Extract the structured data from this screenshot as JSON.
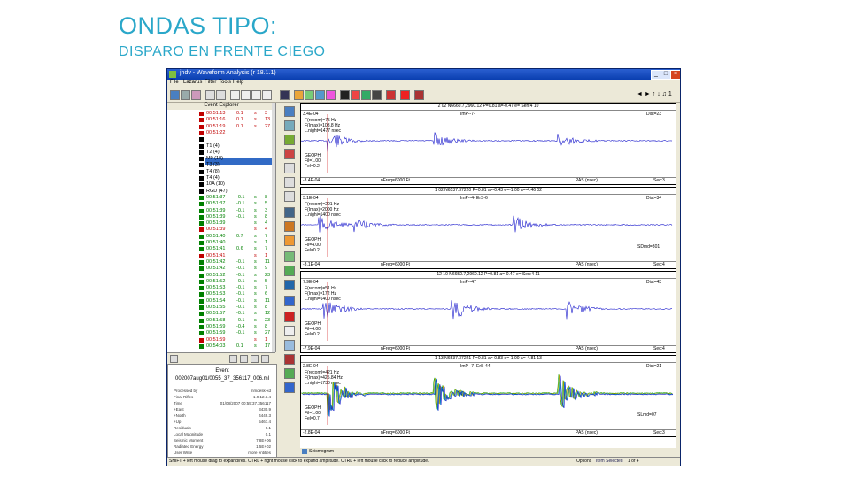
{
  "slide": {
    "title": "ONDAS TIPO:",
    "subtitle": "DISPARO EN FRENTE CIEGO"
  },
  "window": {
    "title": "jhdv - Waveform Analysis (r 18.1.1)",
    "controls": [
      "_",
      "□",
      "×"
    ]
  },
  "menu": [
    "File",
    "Lazarus",
    "Filter",
    "Tools",
    "Help"
  ],
  "toolbar": {
    "right_text": "◄ ► ↑ ↓ ♫ 1"
  },
  "explorer": {
    "header": "Event Explorer",
    "events": [
      {
        "time": "00:51:13",
        "a": "0.1",
        "b": "s",
        "c": "3",
        "color": "#c00000"
      },
      {
        "time": "00:51:16",
        "a": "0.1",
        "b": "s",
        "c": "13",
        "color": "#c00000"
      },
      {
        "time": "00:51:19",
        "a": "0.1",
        "b": "s",
        "c": "27",
        "color": "#c00000"
      },
      {
        "time": "00:51:22",
        "a": "",
        "b": "",
        "c": "",
        "color": "#c00000"
      },
      {
        "time": "T0 (3)",
        "a": "",
        "b": "",
        "c": "",
        "color": "#000000"
      },
      {
        "time": "T1 (4)",
        "a": "",
        "b": "",
        "c": "",
        "color": "#000000"
      },
      {
        "time": "T2 (4)",
        "a": "",
        "b": "",
        "c": "",
        "color": "#000000"
      },
      {
        "time": "M0 (10)",
        "a": "",
        "b": "",
        "c": "",
        "color": "#000000"
      },
      {
        "time": "T3 (3)",
        "a": "",
        "b": "",
        "c": "",
        "color": "#000000"
      },
      {
        "time": "T4 (8)",
        "a": "",
        "b": "",
        "c": "",
        "color": "#000000"
      },
      {
        "time": "T4 (4)",
        "a": "",
        "b": "",
        "c": "",
        "color": "#000000"
      },
      {
        "time": "10A (10)",
        "a": "",
        "b": "",
        "c": "",
        "color": "#000000"
      },
      {
        "time": "RGD (47)",
        "a": "",
        "b": "",
        "c": "",
        "color": "#000000"
      },
      {
        "time": "00:51:37",
        "a": "-0.1",
        "b": "s",
        "c": "8",
        "color": "#008000"
      },
      {
        "time": "00:51:37",
        "a": "-0.1",
        "b": "s",
        "c": "5",
        "color": "#008000"
      },
      {
        "time": "00:51:39",
        "a": "-0.1",
        "b": "s",
        "c": "3",
        "color": "#008000"
      },
      {
        "time": "00:51:39",
        "a": "-0.1",
        "b": "s",
        "c": "8",
        "color": "#008000"
      },
      {
        "time": "00:51:39",
        "a": "",
        "b": "s",
        "c": "4",
        "color": "#008000"
      },
      {
        "time": "00:51:39",
        "a": "",
        "b": "s",
        "c": "4",
        "color": "#c00000"
      },
      {
        "time": "00:51:40",
        "a": "0.7",
        "b": "s",
        "c": "7",
        "color": "#008000"
      },
      {
        "time": "00:51:40",
        "a": "",
        "b": "s",
        "c": "1",
        "color": "#008000"
      },
      {
        "time": "00:51:41",
        "a": "0.6",
        "b": "s",
        "c": "7",
        "color": "#008000"
      },
      {
        "time": "00:51:41",
        "a": "",
        "b": "s",
        "c": "1",
        "color": "#c00000"
      },
      {
        "time": "00:51:42",
        "a": "-0.1",
        "b": "s",
        "c": "11",
        "color": "#008000"
      },
      {
        "time": "00:51:42",
        "a": "-0.1",
        "b": "s",
        "c": "9",
        "color": "#008000"
      },
      {
        "time": "00:51:52",
        "a": "-0.1",
        "b": "s",
        "c": "23",
        "color": "#008000"
      },
      {
        "time": "00:51:52",
        "a": "-0.1",
        "b": "s",
        "c": "5",
        "color": "#008000"
      },
      {
        "time": "00:51:53",
        "a": "-0.1",
        "b": "s",
        "c": "7",
        "color": "#008000"
      },
      {
        "time": "00:51:53",
        "a": "-0.1",
        "b": "s",
        "c": "6",
        "color": "#008000"
      },
      {
        "time": "00:51:54",
        "a": "-0.1",
        "b": "s",
        "c": "11",
        "color": "#008000"
      },
      {
        "time": "00:51:55",
        "a": "-0.1",
        "b": "s",
        "c": "8",
        "color": "#008000"
      },
      {
        "time": "00:51:57",
        "a": "-0.1",
        "b": "s",
        "c": "12",
        "color": "#008000"
      },
      {
        "time": "00:51:58",
        "a": "-0.1",
        "b": "s",
        "c": "23",
        "color": "#008000"
      },
      {
        "time": "00:51:59",
        "a": "-0.4",
        "b": "s",
        "c": "8",
        "color": "#008000"
      },
      {
        "time": "00:51:59",
        "a": "-0.1",
        "b": "s",
        "c": "27",
        "color": "#008000"
      },
      {
        "time": "00:51:59",
        "a": "",
        "b": "s",
        "c": "1",
        "color": "#c00000"
      },
      {
        "time": "00:54:03",
        "a": "0.1",
        "b": "s",
        "c": "17",
        "color": "#008000"
      }
    ]
  },
  "event_info": {
    "label": "Event",
    "name": "002007aug01/0055_37_356117_006.ml",
    "fields": [
      {
        "k": "Processed by",
        "v": "mmdesk-kd"
      },
      {
        "k": "Final Rifles",
        "v": "1.9.12.3.4"
      },
      {
        "k": "Time",
        "v": "01/08/2007 00:55:37.356117"
      },
      {
        "k": "+East",
        "v": "3430.9"
      },
      {
        "k": "+North",
        "v": "4449.3"
      },
      {
        "k": "+Up",
        "v": "5467.4"
      },
      {
        "k": "Residuals",
        "v": "0.1"
      },
      {
        "k": "Local Magnitude",
        "v": "0.1"
      },
      {
        "k": "Seismic Moment",
        "v": "7.8E+06"
      },
      {
        "k": "Radiated Energy",
        "v": "1.5E+02"
      },
      {
        "k": "User Write",
        "v": "more entities"
      }
    ]
  },
  "panels": [
    {
      "head": "2  02  N6660.7,2960.12  P=0.81  a=-0.47  e= Sen:4  10",
      "left": "3.4E-04",
      "center": "ImP--7-",
      "right": "Dist=23",
      "lines": [
        "F(recom)=75 Hz",
        "F(Imax)=103.8 Hz",
        "L.night=1477 nsec"
      ],
      "geo": [
        "GEOPH",
        "Fil=1.00",
        "Fel=0.2"
      ],
      "foot_left": "-3.4E-04",
      "foot_mid": "nFreq=6000 Ft",
      "foot_pas": "PAS (nsec)",
      "foot_right": "Sec:3",
      "extra": ""
    },
    {
      "head": "1  02  N6537.37220  P=0.81  a=-0.43  e=-1.00  a=-4.46  02",
      "left": "3.1E-04",
      "center": "ImP--4-  ErS-6",
      "right": "Dist=34",
      "lines": [
        "F(recom)=201 Hz",
        "F(Imax)=2000 Hz",
        "L.nighi=1400 nsec"
      ],
      "geo": [
        "GEOPH",
        "Fil=4.00",
        "Fel=0.2"
      ],
      "foot_left": "-3.1E-04",
      "foot_mid": "nFreq=6000 Ft",
      "foot_pas": "PAS (nsec)",
      "foot_right": "Sec:4",
      "extra": "SDmd=301"
    },
    {
      "head": "12  10  N6650.7,2960.12  P=0.81  a=-0.47  e= Sen:4  11",
      "left": "7.9E-04",
      "center": "ImP--47",
      "right": "Dist=43",
      "lines": [
        "F(recom)=51 Hz",
        "F(Imax)=172 Hz",
        "L.nighi=1400 nsec"
      ],
      "geo": [
        "GEOPH",
        "Fil=4.00",
        "Fel=0.2"
      ],
      "foot_left": "-7.9E-04",
      "foot_mid": "nFreq=6000 Ft",
      "foot_pas": "PAS (nsec)",
      "foot_right": "Sec:4",
      "extra": ""
    },
    {
      "head": "1  13  N6537.37221  P=0.81  a=-0.83  e=-1.00  a=-4.81  13",
      "left": "2.8E-04",
      "center": "ImP--7-  ErS-44",
      "right": "Dist=21",
      "lines": [
        "F(recom)=421 Hz",
        "F(Imax)=425.84 Hz",
        "L.nighi=1730 nsec"
      ],
      "geo": [
        "GEOPH",
        "Fil=1.00",
        "Fel=0.7"
      ],
      "foot_left": "-2.8E-04",
      "foot_mid": "nFreq=6000 Ft",
      "foot_pas": "PAS (nsec)",
      "foot_right": "Sec:3",
      "extra": "SLmd=07"
    }
  ],
  "seismogram_tab": "Seismogram",
  "status": {
    "left": "SHIFT + left mouse drag to expand/res. CTRL + right mouse click to expand amplitude. CTRL + left mouse click to reduce amplitude.",
    "options": "Options",
    "mode": "Item Selected",
    "page": "1 of 4"
  }
}
